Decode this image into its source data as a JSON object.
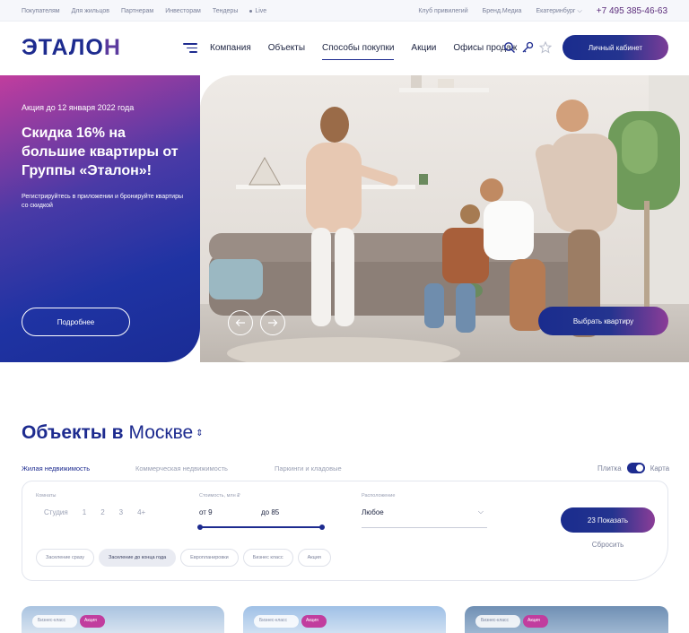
{
  "topbar": {
    "links": [
      "Покупателям",
      "Для жильцов",
      "Партнерам",
      "Инвесторам",
      "Тендеры",
      "Live"
    ],
    "right_links": [
      "Клуб привилегий",
      "Бренд.Медиа",
      "Екатеринбург"
    ],
    "phone": "+7 495 385-46-63"
  },
  "header": {
    "logo": "ЭТАЛО",
    "logo_last": "Н",
    "nav": [
      "Компания",
      "Объекты",
      "Способы покупки",
      "Акции",
      "Офисы продаж"
    ],
    "cabinet_button": "Личный кабинет"
  },
  "hero": {
    "date": "Акция до 12 января 2022 года",
    "title": "Скидка 16% на большие квартиры от Группы «Эталон»!",
    "description": "Регистрируйтесь в приложении и бронируйте квартиры со скидкой",
    "more_button": "Подробнее",
    "choose_button": "Выбрать квартиру"
  },
  "objects": {
    "title": "Объекты в",
    "city": "Москве",
    "tabs": [
      "Жилая недвижимость",
      "Коммерческая недвижимость",
      "Паркинги и кладовые"
    ],
    "view_tile": "Плитка",
    "view_map": "Карта"
  },
  "filter": {
    "rooms_label": "Комнаты",
    "rooms": [
      "Студия",
      "1",
      "2",
      "3",
      "4+"
    ],
    "price_label": "Стоимость, млн ₽",
    "price_from": "от 9",
    "price_to": "до 85",
    "location_label": "Расположение",
    "location_value": "Любое",
    "show_button": "23 Показать",
    "reset": "Сбросить",
    "chips": [
      "Заселение сразу",
      "Заселение до конца года",
      "Европланировки",
      "Бизнес класс",
      "Акция"
    ]
  },
  "cards": [
    {
      "badge": "Бизнес-класс",
      "tag": "Акция"
    },
    {
      "badge": "Бизнес-класс",
      "tag": "Акция"
    },
    {
      "badge": "Бизнес-класс",
      "tag": "Акция"
    }
  ]
}
